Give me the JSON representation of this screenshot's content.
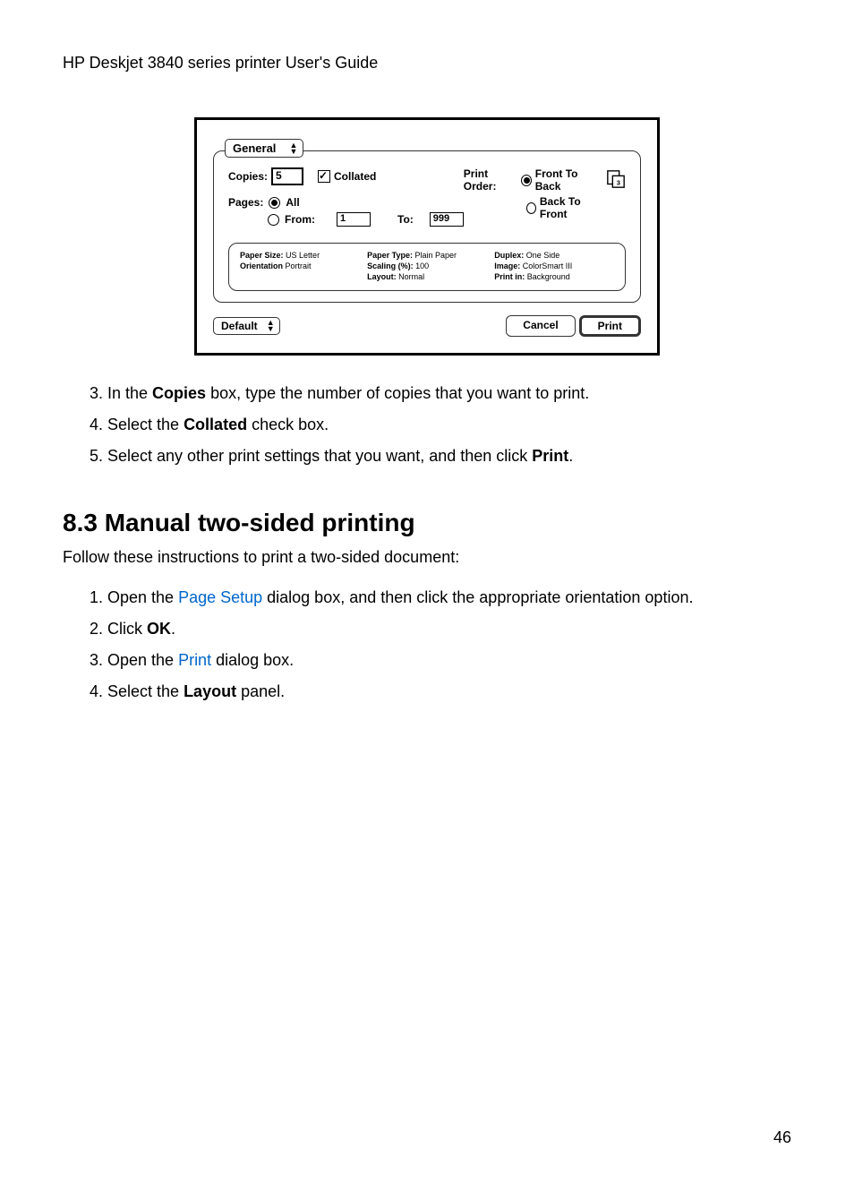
{
  "header": "HP Deskjet 3840 series printer User's Guide",
  "dlg": {
    "panel_name": "General",
    "copies_label": "Copies:",
    "copies_value": "5",
    "collated_label": "Collated",
    "print_order_label": "Print Order:",
    "order_front": "Front To Back",
    "order_back": "Back To Front",
    "pages_label": "Pages:",
    "pages_all": "All",
    "pages_from": "From:",
    "pages_from_val": "1",
    "pages_to": "To:",
    "pages_to_val": "999",
    "summary": {
      "paper_size_l": "Paper Size:",
      "paper_size_v": "US Letter",
      "orientation_l": "Orientation",
      "orientation_v": "Portrait",
      "paper_type_l": "Paper Type:",
      "paper_type_v": "Plain Paper",
      "scaling_l": "Scaling (%):",
      "scaling_v": "100",
      "layout_l": "Layout:",
      "layout_v": "Normal",
      "duplex_l": "Duplex:",
      "duplex_v": "One Side",
      "image_l": "Image:",
      "image_v": "ColorSmart III",
      "printin_l": "Print in:",
      "printin_v": "Background"
    },
    "default_btn": "Default",
    "cancel_btn": "Cancel",
    "print_btn": "Print"
  },
  "steps_a": [
    {
      "n": "3.",
      "pre": "In the ",
      "b": "Copies",
      "post": " box, type the number of copies that you want to print."
    },
    {
      "n": "4.",
      "pre": "Select the ",
      "b": "Collated",
      "post": " check box."
    },
    {
      "n": "5.",
      "pre": "Select any other print settings that you want, and then click ",
      "b": "Print",
      "post": "."
    }
  ],
  "section_h": "8.3  Manual two-sided printing",
  "section_intro": "Follow these instructions to print a two-sided document:",
  "steps_b": [
    {
      "n": "1.",
      "pre": "Open the ",
      "link": "Page Setup",
      "post": " dialog box, and then click the appropriate orientation option."
    },
    {
      "n": "2.",
      "pre": "Click ",
      "b": "OK",
      "post": "."
    },
    {
      "n": "3.",
      "pre": "Open the ",
      "link": "Print",
      "post": " dialog box."
    },
    {
      "n": "4.",
      "pre": "Select the ",
      "b": "Layout",
      "post": " panel."
    }
  ],
  "page_number": "46"
}
